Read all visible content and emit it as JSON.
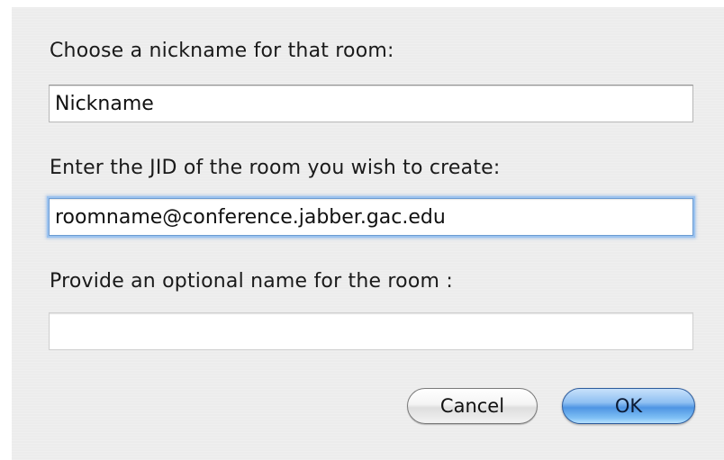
{
  "dialog": {
    "nickname": {
      "label": "Choose a nickname for that room:",
      "value": "Nickname"
    },
    "jid": {
      "label": "Enter the JID of the room you wish to create:",
      "value": "roomname@conference.jabber.gac.edu"
    },
    "room_name": {
      "label": "Provide an optional name for the room :",
      "value": ""
    },
    "buttons": {
      "cancel_label": "Cancel",
      "ok_label": "OK"
    }
  },
  "colors": {
    "dialog_background": "#ececec",
    "focus_ring": "#9cc3ef",
    "default_button": "#4e95e3"
  }
}
